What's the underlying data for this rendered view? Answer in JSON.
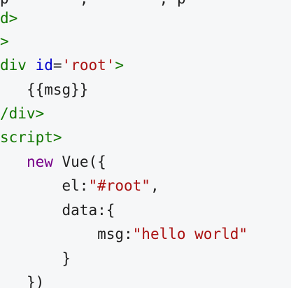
{
  "editor": {
    "lines": [
      {
        "indent": "",
        "tokens": [
          {
            "text": "p",
            "kind": "plain"
          },
          {
            "text": "        ",
            "kind": "plain"
          },
          {
            "text": ",",
            "kind": "plain"
          },
          {
            "text": "        ",
            "kind": "plain"
          },
          {
            "text": ",",
            "kind": "plain"
          },
          {
            "text": " ",
            "kind": "plain"
          },
          {
            "text": "p",
            "kind": "plain"
          }
        ]
      },
      {
        "indent": "",
        "tokens": [
          {
            "text": "d>",
            "kind": "tag"
          }
        ]
      },
      {
        "indent": "",
        "tokens": [
          {
            "text": ">",
            "kind": "tag"
          }
        ]
      },
      {
        "indent": "",
        "tokens": [
          {
            "text": "div",
            "kind": "tag"
          },
          {
            "text": " ",
            "kind": "plain"
          },
          {
            "text": "id",
            "kind": "attr"
          },
          {
            "text": "=",
            "kind": "plain"
          },
          {
            "text": "'root'",
            "kind": "str"
          },
          {
            "text": ">",
            "kind": "tag"
          }
        ]
      },
      {
        "indent": "   ",
        "tokens": [
          {
            "text": "{{msg}}",
            "kind": "plain"
          }
        ]
      },
      {
        "indent": "",
        "tokens": [
          {
            "text": "/div>",
            "kind": "tag"
          }
        ]
      },
      {
        "indent": "",
        "tokens": [
          {
            "text": "script>",
            "kind": "tag"
          }
        ]
      },
      {
        "indent": "   ",
        "tokens": [
          {
            "text": "new",
            "kind": "kw"
          },
          {
            "text": " ",
            "kind": "plain"
          },
          {
            "text": "Vue({",
            "kind": "plain"
          }
        ]
      },
      {
        "indent": "       ",
        "tokens": [
          {
            "text": "el:",
            "kind": "plain"
          },
          {
            "text": "\"#root\"",
            "kind": "str"
          },
          {
            "text": ",",
            "kind": "plain"
          }
        ]
      },
      {
        "indent": "       ",
        "tokens": [
          {
            "text": "data:{",
            "kind": "plain"
          }
        ]
      },
      {
        "indent": "           ",
        "tokens": [
          {
            "text": "msg:",
            "kind": "plain"
          },
          {
            "text": "\"hello world\"",
            "kind": "str"
          }
        ]
      },
      {
        "indent": "       ",
        "tokens": [
          {
            "text": "}",
            "kind": "plain"
          }
        ]
      },
      {
        "indent": "   ",
        "tokens": [
          {
            "text": "})",
            "kind": "plain"
          }
        ]
      }
    ]
  }
}
